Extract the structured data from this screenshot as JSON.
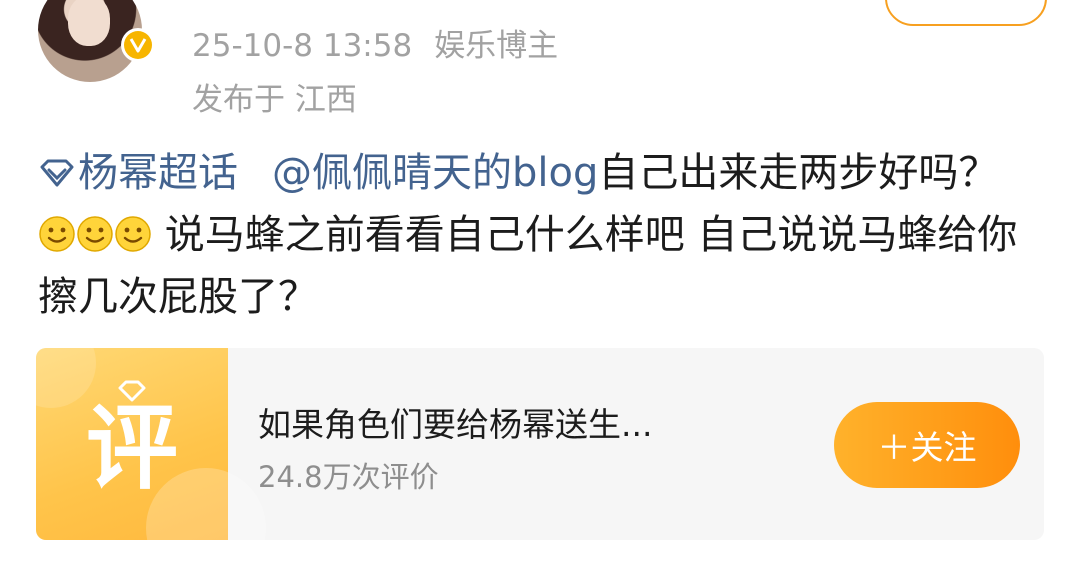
{
  "post": {
    "timestamp": "25-10-8 13:58",
    "user_label": "娱乐博主",
    "location": "发布于 江西",
    "topic_link": "杨幂超话",
    "mention_link": "@佩佩晴天的blog",
    "text_part1": "自己出来走两步好吗？",
    "emoji_count": 3,
    "text_part2": "说马蜂之前看看自己什么样吧 自己说说马蜂给你擦几次屁股了？"
  },
  "card": {
    "title": "如果角色们要给杨幂送生...",
    "subtitle": "24.8万次评价",
    "follow_label": "＋关注",
    "thumb_glyph": "评"
  },
  "colors": {
    "accent_orange": "#ff9a1a",
    "link_blue": "#43638f",
    "verified_gold": "#f7b500"
  },
  "icons": [
    "verified-icon",
    "topic-diamond-icon",
    "smile-emoji-icon",
    "plus-icon"
  ]
}
